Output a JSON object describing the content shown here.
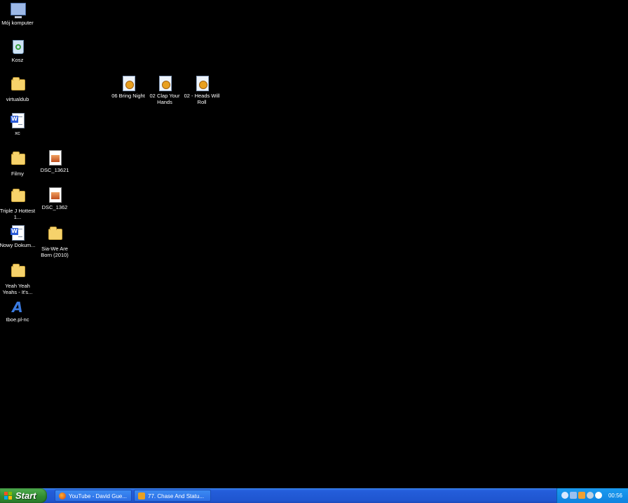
{
  "desktop": {
    "icons": {
      "my_computer": "Mój komputer",
      "recycle_bin": "Kosz",
      "virtualdub": "virtualdub",
      "xc": "xc",
      "filmy": "Filmy",
      "dsc_13621": "DSC_13621",
      "triple_j": "Triple J Hottest 1...",
      "dsc_1362": "DSC_1362",
      "nowy_dokum": "Nowy Dokum...",
      "sia": "Sia-We Are Born (2010)",
      "yeah_yeah": "Yeah Yeah Yeahs - It's...",
      "tboe": "tboe.pl-nc",
      "bring_night": "06 Bring Night",
      "clap_hands": "02 Clap Your Hands",
      "heads_roll": "02 - Heads Will Roll"
    }
  },
  "taskbar": {
    "start_label": "Start",
    "tasks": [
      {
        "label": "YouTube - David Gue..."
      },
      {
        "label": "77. Chase And Statu..."
      }
    ],
    "clock": "00:56"
  },
  "colors": {
    "desktop_bg": "#000000",
    "taskbar_blue": "#245edb",
    "start_green": "#2f8a2f",
    "tray_blue": "#0f82df"
  }
}
